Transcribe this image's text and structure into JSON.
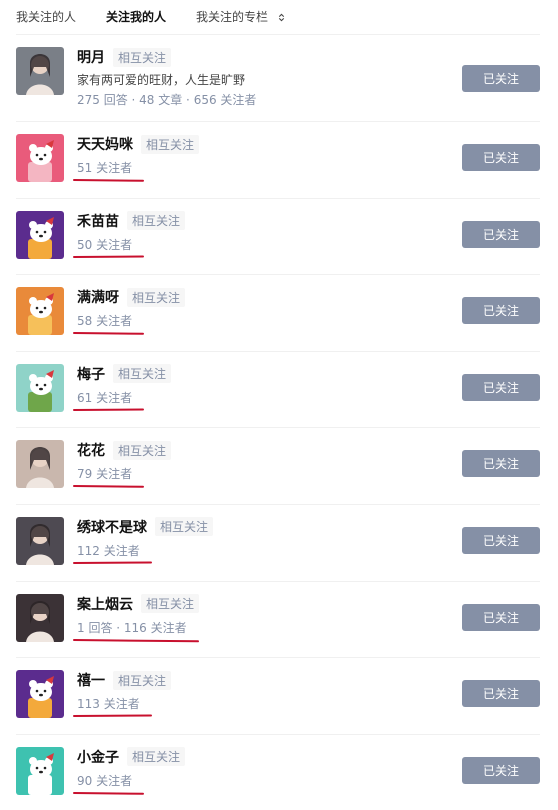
{
  "tabs": [
    {
      "label": "我关注的人"
    },
    {
      "label": "关注我的人"
    },
    {
      "label": "我关注的专栏"
    }
  ],
  "mutual_label": "相互关注",
  "follow_button_label": "已关注",
  "colors": {
    "button": "#8590a6",
    "mutual_text": "#8590a6",
    "underline": "#c8102e"
  },
  "users": [
    {
      "name": "明月",
      "bio": "家有两可爱的旺财，人生是旷野",
      "meta": "275 回答 · 48 文章 · 656 关注者",
      "avatar": "photo"
    },
    {
      "name": "天天妈咪",
      "meta": "51 关注者",
      "avatar": "bear-pink"
    },
    {
      "name": "禾苗苗",
      "meta": "50 关注者",
      "avatar": "bear-purple"
    },
    {
      "name": "满满呀",
      "meta": "58 关注者",
      "avatar": "bear-orange"
    },
    {
      "name": "梅子",
      "meta": "61 关注者",
      "avatar": "bear-mint"
    },
    {
      "name": "花花",
      "meta": "79 关注者",
      "avatar": "photo"
    },
    {
      "name": "绣球不是球",
      "meta": "112 关注者",
      "avatar": "photo"
    },
    {
      "name": "案上烟云",
      "meta": "1 回答 · 116 关注者",
      "avatar": "photo"
    },
    {
      "name": "禧一",
      "meta": "113 关注者",
      "avatar": "bear-purple"
    },
    {
      "name": "小金子",
      "meta": "90 关注者",
      "avatar": "bear-teal"
    }
  ]
}
